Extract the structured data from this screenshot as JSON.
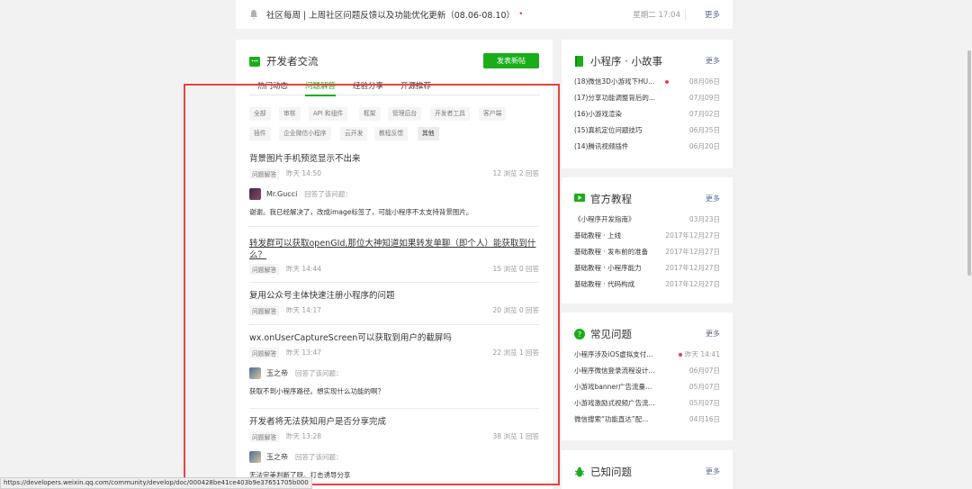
{
  "announcement": {
    "text": "社区每周 | 上周社区问题反馈以及功能优化更新（08.06-08.10）",
    "date": "星期二 17:04",
    "more": "更多"
  },
  "main": {
    "title": "开发者交流",
    "post_button": "发表新帖",
    "tabs": [
      "热门动态",
      "问题解答",
      "经验分享",
      "开源推荐"
    ],
    "active_tab": "问题解答",
    "tags": [
      "全部",
      "审核",
      "API 和组件",
      "框架",
      "管理后台",
      "开发者工具",
      "客户端",
      "插件",
      "企业微信小程序",
      "云开发",
      "教程反馈",
      "其他"
    ],
    "selected_tag": "其他",
    "posts": [
      {
        "title": "背景图片手机预览显示不出来",
        "category": "问题解答",
        "time": "昨天 14:50",
        "stats": "12 浏览   2 回答",
        "answer_user": "Mr.Gucci",
        "answer_action": "回答了该问题：",
        "answer_text": "谢谢。我已经解决了，改成image标签了，可能小程序不太支持背景图片。"
      },
      {
        "title": "转发群可以获取openGId,那位大神知道如果转发单聊（即个人）能获取到什么？",
        "category": "问题解答",
        "time": "昨天 14:44",
        "stats": "15 浏览   0 回答"
      },
      {
        "title": "复用公众号主体快速注册小程序的问题",
        "category": "问题解答",
        "time": "昨天 14:17",
        "stats": "20 浏览   0 回答"
      },
      {
        "title": "wx.onUserCaptureScreen可以获取到用户的截屏吗",
        "category": "问题解答",
        "time": "昨天 13:47",
        "stats": "22 浏览   1 回答",
        "answer_user": "玉之帝",
        "answer_action": "回答了该问题：",
        "answer_text": "获取不到小程序路径。想实现什么功能的啊？"
      },
      {
        "title": "开发者将无法获知用户是否分享完成",
        "category": "问题解答",
        "time": "昨天 13:28",
        "stats": "38 浏览   1 回答",
        "answer_user": "玉之帝",
        "answer_action": "回答了该问题：",
        "answer_text": "无法完美判断了呀。打击诱导分享"
      }
    ]
  },
  "sidebar": {
    "stories": {
      "title": "小程序 · 小故事",
      "more": "更多",
      "items": [
        {
          "title": "(18)微信3D小游戏下HU...",
          "date": "08月06日"
        },
        {
          "title": "(17)分享功能调整背后的...",
          "date": "07月09日"
        },
        {
          "title": "(16)小游戏渲染",
          "date": "07月02日"
        },
        {
          "title": "(15)真机定位问题技巧",
          "date": "06月25日"
        },
        {
          "title": "(14)腾讯视频插件",
          "date": "06月20日"
        }
      ]
    },
    "tutorials": {
      "title": "官方教程",
      "more": "更多",
      "items": [
        {
          "title": "《小程序开发指南》",
          "date": "03月23日"
        },
        {
          "title": "基础教程 · 上线",
          "date": "2017年12月27日"
        },
        {
          "title": "基础教程 · 发布前的准备",
          "date": "2017年12月27日"
        },
        {
          "title": "基础教程 · 小程序能力",
          "date": "2017年12月27日"
        },
        {
          "title": "基础教程 · 代码构成",
          "date": "2017年12月27日"
        }
      ]
    },
    "faq": {
      "title": "常见问题",
      "more": "更多",
      "items": [
        {
          "title": "小程序涉及iOS虚拟支付...",
          "date": "昨天 14:41"
        },
        {
          "title": "小程序微信登录流程设计...",
          "date": "06月07日"
        },
        {
          "title": "小游戏banner广告流量...",
          "date": "05月07日"
        },
        {
          "title": "小游戏激励式视频广告流...",
          "date": "05月07日"
        },
        {
          "title": "微信搜索“功能直达”配...",
          "date": "04月16日"
        }
      ]
    },
    "known": {
      "title": "已知问题",
      "more": "更多"
    }
  },
  "status_url": "https://developers.weixin.qq.com/community/develop/doc/000428be41ce403b9e37651705b000",
  "colors": {
    "accent": "#1aad19",
    "link": "#576b95",
    "alert": "#e64340"
  }
}
